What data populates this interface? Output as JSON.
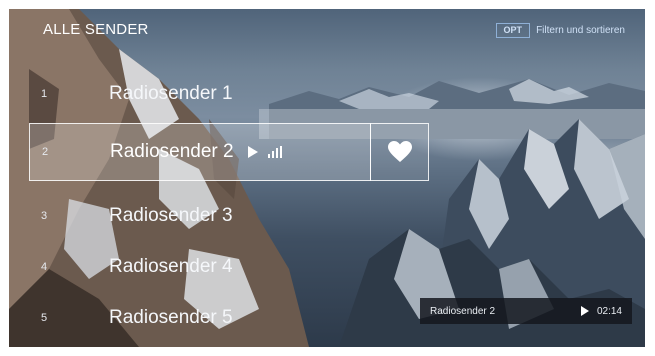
{
  "header": {
    "title": "ALLE SENDER"
  },
  "options": {
    "key": "OPT",
    "label": "Filtern und sortieren"
  },
  "stations": [
    {
      "number": "1",
      "name": "Radiosender 1"
    },
    {
      "number": "2",
      "name": "Radiosender 2"
    },
    {
      "number": "3",
      "name": "Radiosender 3"
    },
    {
      "number": "4",
      "name": "Radiosender 4"
    },
    {
      "number": "5",
      "name": "Radiosender 5"
    }
  ],
  "selected_index": 1,
  "icons": {
    "play": "play-icon",
    "signal": "signal-strength-icon",
    "favorite": "heart-icon"
  },
  "player": {
    "station": "Radiosender 2",
    "time": "02:14"
  },
  "colors": {
    "accent": "#8fb0d6",
    "text": "#ffffff",
    "player_bg": "#14181e"
  }
}
